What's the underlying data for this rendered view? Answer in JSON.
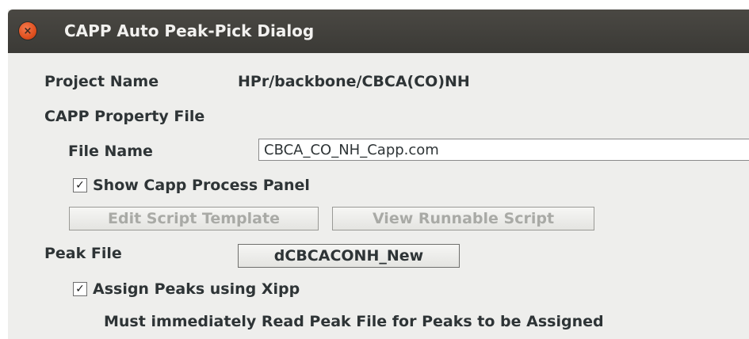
{
  "window": {
    "title": "CAPP Auto Peak-Pick Dialog",
    "close_glyph": "×"
  },
  "project": {
    "label": "Project Name",
    "value": "HPr/backbone/CBCA(CO)NH"
  },
  "property_file": {
    "section_label": "CAPP Property File",
    "file_name_label": "File Name",
    "file_name_value": "CBCA_CO_NH_Capp.com",
    "show_panel": {
      "label": "Show Capp Process Panel",
      "checked": true,
      "mark": "✓"
    },
    "edit_template_label": "Edit Script Template",
    "view_script_label": "View Runnable Script"
  },
  "peak_file": {
    "label": "Peak File",
    "button_label": "dCBCACONH_New",
    "assign_xipp": {
      "label": "Assign Peaks using Xipp",
      "checked": true,
      "mark": "✓"
    },
    "note": "Must immediately Read Peak File for Peaks to be Assigned"
  },
  "icons": {
    "close": "close-icon",
    "checkbox": "checkmark-icon"
  },
  "colors": {
    "titlebar": "#3b3a36",
    "close_button": "#e0501f",
    "dialog_bg": "#eeeeec",
    "text": "#2e3436",
    "disabled_text": "#a9aaa6"
  }
}
